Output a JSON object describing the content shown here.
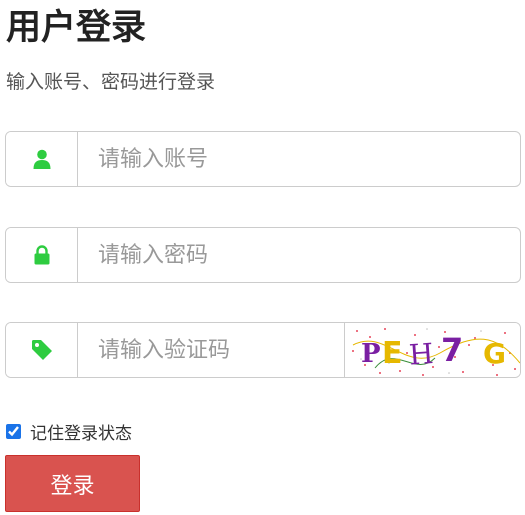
{
  "header": {
    "title": "用户登录",
    "subtitle": "输入账号、密码进行登录"
  },
  "form": {
    "account": {
      "icon": "user-icon",
      "placeholder": "请输入账号",
      "value": ""
    },
    "password": {
      "icon": "lock-icon",
      "placeholder": "请输入密码",
      "value": ""
    },
    "captcha": {
      "icon": "tag-icon",
      "placeholder": "请输入验证码",
      "value": "",
      "image_text": "PEH7G"
    },
    "remember": {
      "label": "记住登录状态",
      "checked": true
    },
    "submit_label": "登录"
  },
  "colors": {
    "icon": "#2ecc40",
    "button": "#d9534f",
    "checkbox": "#1a73e8"
  }
}
